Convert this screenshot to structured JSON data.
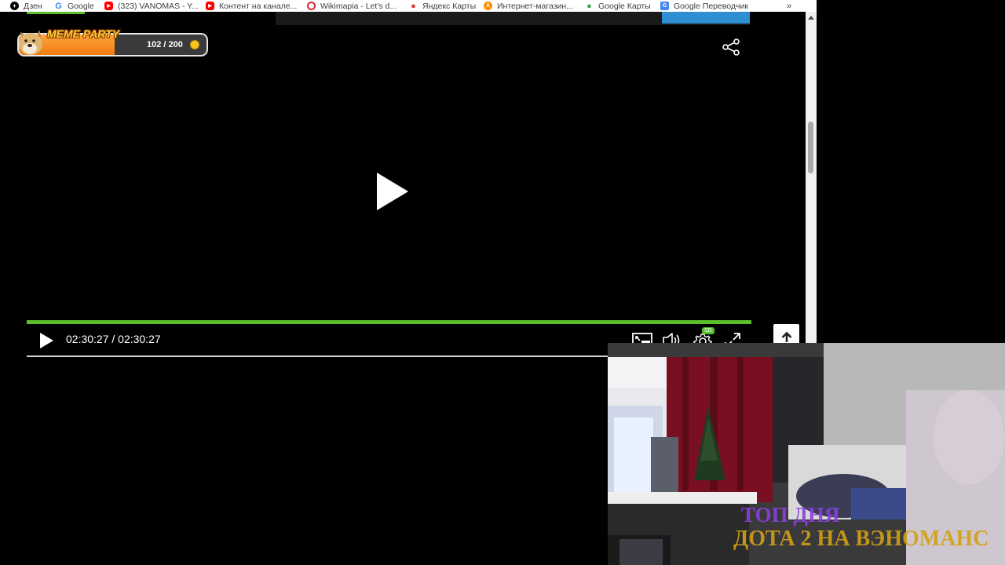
{
  "bookmarks": [
    {
      "label": "Дзен",
      "icon": "dzen-icon",
      "color": "#000000"
    },
    {
      "label": "Google",
      "icon": "google-icon",
      "color": "#4285f4"
    },
    {
      "label": "(323) VANOMAS - Y...",
      "icon": "youtube-icon",
      "color": "#ff0000"
    },
    {
      "label": "Контент на канале...",
      "icon": "youtube-studio-icon",
      "color": "#ff0000"
    },
    {
      "label": "Wikimapia - Let's d...",
      "icon": "wikimapia-icon",
      "color": "#d6262f"
    },
    {
      "label": "Яндекс Карты",
      "icon": "map-pin-icon",
      "color": "#e53935"
    },
    {
      "label": "Интернет-магазин...",
      "icon": "aliexpress-icon",
      "color": "#ff8a00"
    },
    {
      "label": "Google Карты",
      "icon": "google-maps-icon",
      "color": "#34a853"
    },
    {
      "label": "Google Переводчик",
      "icon": "google-translate-icon",
      "color": "#4285f4"
    }
  ],
  "bookmarks_more": "»",
  "player": {
    "time": "02:30:27 / 02:30:27",
    "progress": 1.0,
    "quality_badge": "SD",
    "accent": "#5bbf2b"
  },
  "meme_party": {
    "title": "MEME PARTY",
    "count": "102 / 200",
    "progress": 0.51
  },
  "webcam_overlay": {
    "line1": "ТОП ДНЯ",
    "line2": "ДОТА 2 НА ВЭНОМАНС"
  }
}
